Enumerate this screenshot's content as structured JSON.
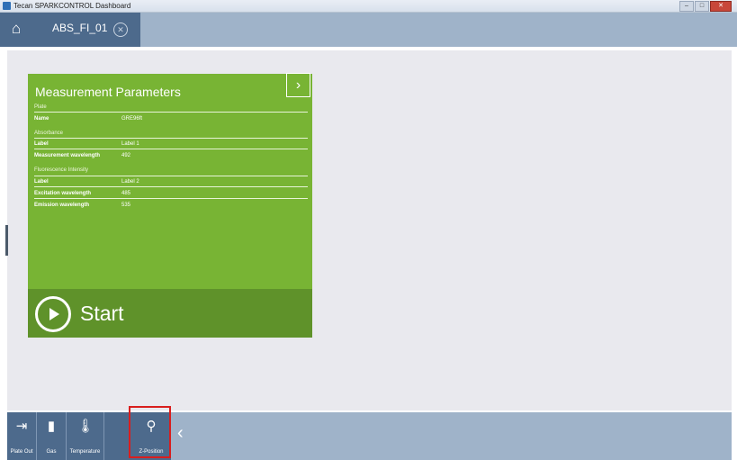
{
  "window": {
    "title": "Tecan SPARKCONTROL Dashboard"
  },
  "nav": {
    "tab_label": "ABS_FI_01"
  },
  "card": {
    "title": "Measurement Parameters",
    "sections": [
      {
        "header": "Plate",
        "rows": [
          {
            "key": "Name",
            "value": "GRE96ft"
          }
        ]
      },
      {
        "header": "Absorbance",
        "rows": [
          {
            "key": "Label",
            "value": "Label 1"
          },
          {
            "key": "Measurement wavelength",
            "value": "492"
          }
        ]
      },
      {
        "header": "Fluorescence Intensity",
        "rows": [
          {
            "key": "Label",
            "value": "Label 2"
          },
          {
            "key": "Excitation wavelength",
            "value": "485"
          },
          {
            "key": "Emission wavelength",
            "value": "535"
          }
        ]
      }
    ],
    "start_label": "Start",
    "accent_color": "#78b434"
  },
  "toolbar": {
    "items": [
      {
        "label": "Plate Out",
        "icon": "plate-out-icon"
      },
      {
        "label": "Gas",
        "icon": "gas-cylinder-icon"
      },
      {
        "label": "Temperature",
        "icon": "thermometer-icon"
      },
      {
        "label": "Z-Position",
        "icon": "z-position-icon"
      }
    ]
  }
}
